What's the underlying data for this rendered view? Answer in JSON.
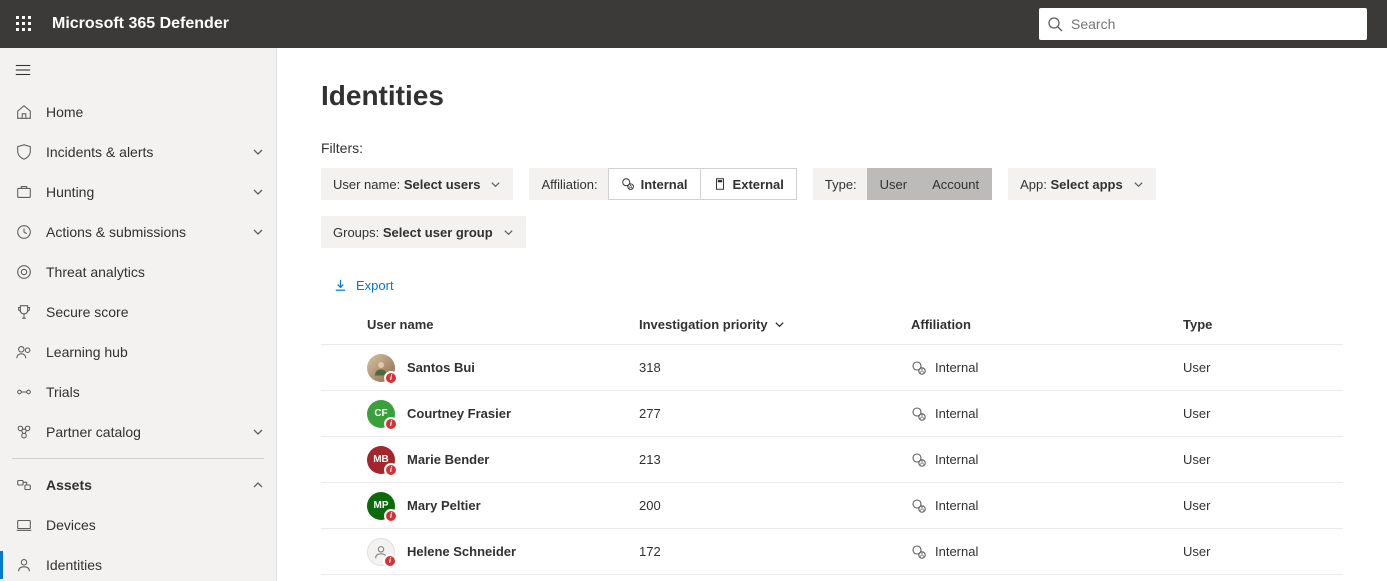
{
  "app_title": "Microsoft 365 Defender",
  "search": {
    "placeholder": "Search"
  },
  "sidebar": {
    "items": [
      {
        "label": "Home"
      },
      {
        "label": "Incidents & alerts"
      },
      {
        "label": "Hunting"
      },
      {
        "label": "Actions & submissions"
      },
      {
        "label": "Threat analytics"
      },
      {
        "label": "Secure score"
      },
      {
        "label": "Learning hub"
      },
      {
        "label": "Trials"
      },
      {
        "label": "Partner catalog"
      },
      {
        "label": "Assets"
      },
      {
        "label": "Devices"
      },
      {
        "label": "Identities"
      }
    ]
  },
  "page": {
    "title": "Identities",
    "filters_label": "Filters:",
    "username_label": "User name:",
    "username_value": "Select users",
    "affiliation_label": "Affiliation:",
    "internal": "Internal",
    "external": "External",
    "type_label": "Type:",
    "type_user": "User",
    "type_account": "Account",
    "app_label": "App:",
    "app_value": "Select apps",
    "groups_label": "Groups:",
    "groups_value": "Select user group",
    "export": "Export",
    "columns": {
      "user": "User name",
      "priority": "Investigation priority",
      "affiliation": "Affiliation",
      "type": "Type"
    },
    "rows": [
      {
        "name": "Santos Bui",
        "priority": "318",
        "affiliation": "Internal",
        "type": "User",
        "avatar_kind": "img",
        "avatar_color": "#3a3a3a",
        "initials": ""
      },
      {
        "name": "Courtney Frasier",
        "priority": "277",
        "affiliation": "Internal",
        "type": "User",
        "avatar_kind": "init",
        "avatar_color": "#3aa03a",
        "initials": "CF"
      },
      {
        "name": "Marie Bender",
        "priority": "213",
        "affiliation": "Internal",
        "type": "User",
        "avatar_kind": "init",
        "avatar_color": "#a4262c",
        "initials": "MB"
      },
      {
        "name": "Mary Peltier",
        "priority": "200",
        "affiliation": "Internal",
        "type": "User",
        "avatar_kind": "init",
        "avatar_color": "#0b6a0b",
        "initials": "MP"
      },
      {
        "name": "Helene Schneider",
        "priority": "172",
        "affiliation": "Internal",
        "type": "User",
        "avatar_kind": "person",
        "avatar_color": "#f3f2f1",
        "initials": ""
      }
    ]
  }
}
